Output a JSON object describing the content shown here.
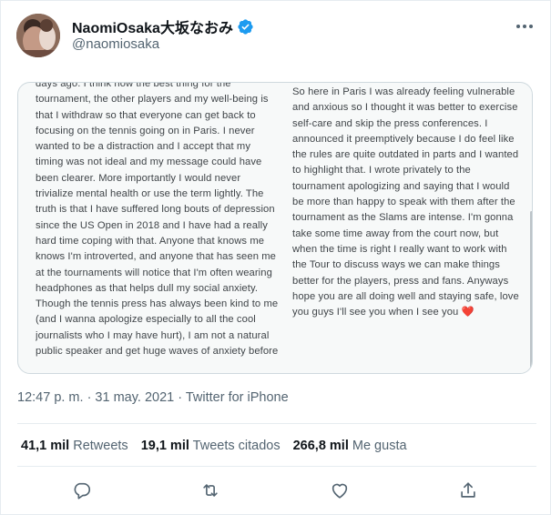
{
  "tweet": {
    "display_name": "NaomiOsaka大坂なおみ",
    "handle": "@naomiosaka",
    "verified_icon": "verified-badge-icon",
    "more_icon": "more-options-icon",
    "timestamp": "12:47 p. m. · 31 may. 2021 · Twitter for iPhone"
  },
  "notes": {
    "left_text": "days ago. I think now the best thing for the tournament, the other players and my well-being is that I withdraw so that everyone can get back to focusing on the tennis going on in Paris. I never wanted to be a distraction and I accept that my timing was not ideal and my message could have been clearer. More importantly I would never trivialize mental health or use the term lightly. The truth is that I have suffered long bouts of depression since the US Open in 2018 and I have had a really hard time coping with that. Anyone that knows me knows I'm introverted, and anyone that has seen me at the tournaments will notice that I'm often wearing headphones as that helps dull my social anxiety. Though the tennis press has always been kind to me (and I wanna apologize especially to all the cool journalists who I may have hurt), I am not a natural public speaker and get huge waves of anxiety before",
    "right_text": "So here in Paris I was already feeling vulnerable and anxious so I thought it was better to exercise self-care and skip the press conferences. I announced it preemptively because I do feel like the rules are quite outdated in parts and I wanted to highlight that. I wrote privately to the tournament apologizing and saying that I would be more than happy to speak with them after the tournament as the Slams are intense. I'm gonna take some time away from the court now, but when the time is right I really want to work with the Tour to discuss ways we can make things better for the players, press and fans. Anyways hope you are all doing well and staying safe, love you guys I'll see you when I see you",
    "heart": "❤️"
  },
  "stats": {
    "retweets_count": "41,1 mil",
    "retweets_label": "Retweets",
    "quotes_count": "19,1 mil",
    "quotes_label": "Tweets citados",
    "likes_count": "266,8 mil",
    "likes_label": "Me gusta"
  },
  "actions": [
    "reply-icon",
    "retweet-icon",
    "like-icon",
    "share-icon"
  ],
  "colors": {
    "primary_text": "#0f1419",
    "secondary_text": "#536471",
    "verified": "#1d9bf0",
    "divider": "#e6ecf0"
  }
}
